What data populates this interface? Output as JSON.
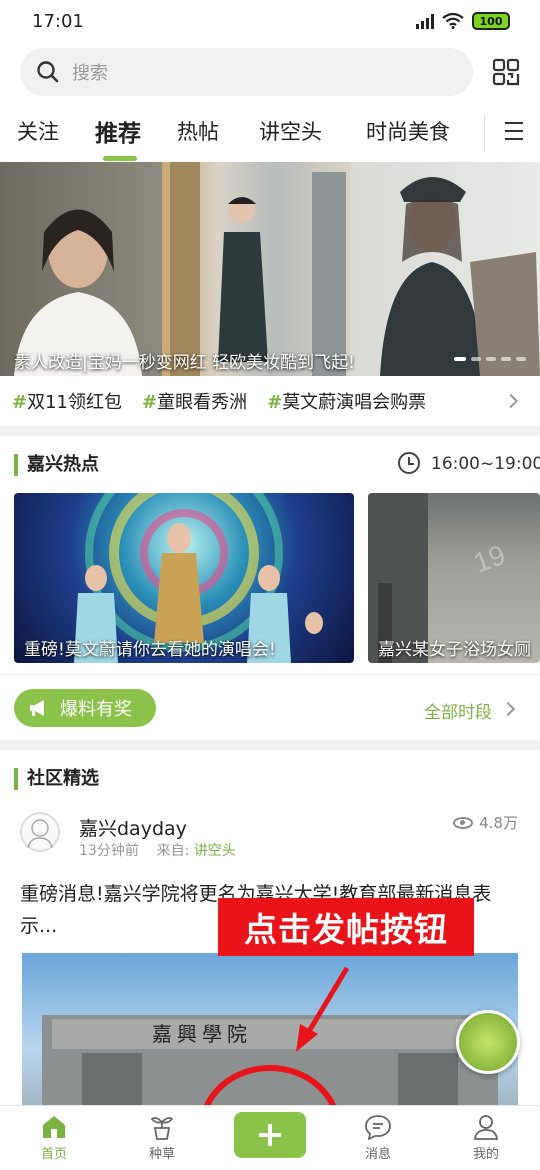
{
  "status_bar": {
    "time": "17:01",
    "battery": "100"
  },
  "search": {
    "placeholder": "搜索"
  },
  "tabs": [
    {
      "label": "关注"
    },
    {
      "label": "推荐"
    },
    {
      "label": "热帖"
    },
    {
      "label": "讲空头"
    },
    {
      "label": "时尚美食"
    }
  ],
  "banner": {
    "caption": "素人改造|宝妈一秒变网红 轻欧美妆酷到飞起!"
  },
  "topics": [
    {
      "hash": "#",
      "label": "双11领红包"
    },
    {
      "hash": "#",
      "label": "童眼看秀洲"
    },
    {
      "hash": "#",
      "label": "莫文蔚演唱会购票"
    }
  ],
  "hot": {
    "title": "嘉兴热点",
    "time_range": "16:00~19:00",
    "cards": [
      {
        "caption": "重磅!莫文蔚请你去看她的演唱会!"
      },
      {
        "caption": "嘉兴某女子浴场女厕"
      }
    ],
    "tip_button": "爆料有奖",
    "all_periods": "全部时段"
  },
  "community": {
    "title": "社区精选",
    "post": {
      "author": "嘉兴dayday",
      "time_ago": "13分钟前",
      "from_label": "来自:",
      "source": "讲空头",
      "views": "4.8万",
      "text": "重磅消息!嘉兴学院将更名为嘉兴大学!教育部最新消息表示..."
    }
  },
  "callout": {
    "text": "点击发帖按钮"
  },
  "bottom_nav": [
    {
      "label": "首页"
    },
    {
      "label": "种草"
    },
    {
      "label": ""
    },
    {
      "label": "消息"
    },
    {
      "label": "我的"
    }
  ],
  "colors": {
    "accent": "#8bc34a",
    "callout": "#e8141a"
  }
}
